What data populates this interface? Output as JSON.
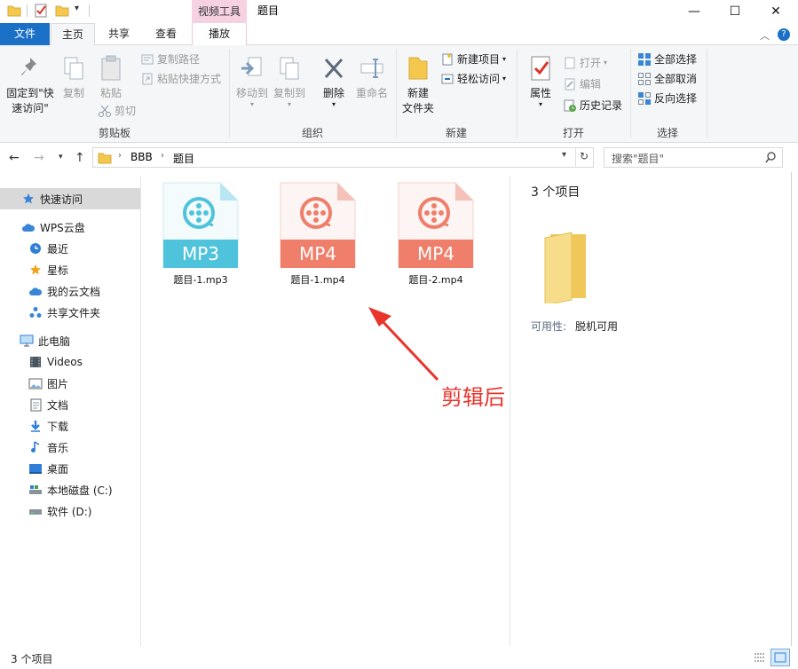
{
  "window": {
    "title": "题目",
    "context_tab_group": "视频工具",
    "controls": {
      "minimize": "—",
      "maximize": "☐",
      "close": "✕"
    }
  },
  "tabs": [
    {
      "label": "文件"
    },
    {
      "label": "主页"
    },
    {
      "label": "共享"
    },
    {
      "label": "查看"
    },
    {
      "label": "播放"
    }
  ],
  "ribbon": {
    "clipboard": {
      "label": "剪贴板",
      "pin_line1": "固定到\"快",
      "pin_line2": "速访问\"",
      "copy": "复制",
      "paste": "粘贴",
      "copy_path": "复制路径",
      "paste_shortcut": "粘贴快捷方式",
      "cut": "剪切"
    },
    "organize": {
      "label": "组织",
      "move_to": "移动到",
      "copy_to": "复制到",
      "delete": "删除",
      "rename": "重命名"
    },
    "new": {
      "label": "新建",
      "new_folder_line1": "新建",
      "new_folder_line2": "文件夹",
      "new_item": "新建项目",
      "easy_access": "轻松访问"
    },
    "open": {
      "label": "打开",
      "properties": "属性",
      "open": "打开",
      "edit": "编辑",
      "history": "历史记录"
    },
    "select": {
      "label": "选择",
      "select_all": "全部选择",
      "select_none": "全部取消",
      "invert": "反向选择"
    }
  },
  "address": {
    "path": [
      "BBB",
      "题目"
    ],
    "search_placeholder": "搜索\"题目\""
  },
  "nav": {
    "quick_access": "快速访问",
    "wps_cloud": "WPS云盘",
    "recent": "最近",
    "starred": "星标",
    "my_cloud_docs": "我的云文档",
    "shared_folder": "共享文件夹",
    "this_pc": "此电脑",
    "videos": "Videos",
    "pictures": "图片",
    "documents": "文档",
    "downloads": "下载",
    "music": "音乐",
    "desktop": "桌面",
    "local_disk": "本地磁盘 (C:)",
    "software_disk": "软件 (D:)"
  },
  "files": [
    {
      "name": "题目-1.mp3",
      "badge": "MP3",
      "color": "#4fc3dc",
      "fold": "#b8e6f2"
    },
    {
      "name": "题目-1.mp4",
      "badge": "MP4",
      "color": "#ef7e6a",
      "fold": "#f6c1b8"
    },
    {
      "name": "题目-2.mp4",
      "badge": "MP4",
      "color": "#ef7e6a",
      "fold": "#f6c1b8"
    }
  ],
  "annotation": {
    "text": "剪辑后",
    "color": "#e8342b"
  },
  "details": {
    "count": "3 个项目",
    "availability_label": "可用性:",
    "availability_value": "脱机可用"
  },
  "status": {
    "count": "3 个项目"
  },
  "colors": {
    "accent": "#1a6fc7",
    "context_tab": "#f5d1e1",
    "selection": "#d9d9d9"
  }
}
